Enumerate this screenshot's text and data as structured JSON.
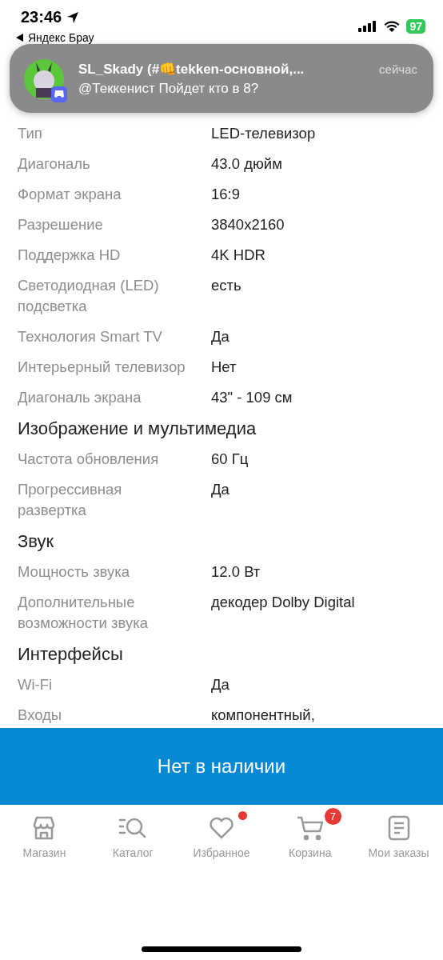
{
  "status_bar": {
    "time": "23:46",
    "battery": "97",
    "back_app": "Яндекс Брау"
  },
  "notification": {
    "title": "SL_Skady (#👊tekken-основной,...",
    "message": "@Теккенист Пойдет кто в 8?",
    "time": "сейчас"
  },
  "sections": [
    {
      "rows": [
        {
          "label": "Тип",
          "value": "LED-телевизор"
        },
        {
          "label": "Диагональ",
          "value": "43.0 дюйм"
        },
        {
          "label": "Формат экрана",
          "value": "16:9"
        },
        {
          "label": "Разрешение",
          "value": "3840x2160"
        },
        {
          "label": "Поддержка HD",
          "value": "4K HDR"
        },
        {
          "label": "Светодиодная (LED) подсветка",
          "value": "есть"
        },
        {
          "label": "Технология Smart TV",
          "value": "Да"
        },
        {
          "label": "Интерьерный телевизор",
          "value": "Нет"
        },
        {
          "label": "Диагональ экрана",
          "value": "43\" - 109 см"
        }
      ]
    },
    {
      "title": "Изображение и мультимедиа",
      "rows": [
        {
          "label": "Частота обновления",
          "value": "60 Гц"
        },
        {
          "label": "Прогрессивная развертка",
          "value": "Да"
        }
      ]
    },
    {
      "title": "Звук",
      "rows": [
        {
          "label": "Мощность звука",
          "value": "12.0 Вт"
        },
        {
          "label": "Дополнительные возможности звука",
          "value": "декодер Dolby Digital"
        }
      ]
    },
    {
      "title": "Интерфейсы",
      "rows": [
        {
          "label": "Wi-Fi",
          "value": "Да"
        },
        {
          "label": "Входы",
          "value": "компонентный,"
        }
      ]
    }
  ],
  "action_button": "Нет в наличии",
  "nav": [
    {
      "label": "Магазин",
      "kind": "shop",
      "dot": false
    },
    {
      "label": "Каталог",
      "kind": "catalog",
      "dot": false
    },
    {
      "label": "Избранное",
      "kind": "heart",
      "dot": true
    },
    {
      "label": "Корзина",
      "kind": "cart",
      "dot": false,
      "badge": "7"
    },
    {
      "label": "Мои заказы",
      "kind": "orders",
      "dot": false
    }
  ]
}
